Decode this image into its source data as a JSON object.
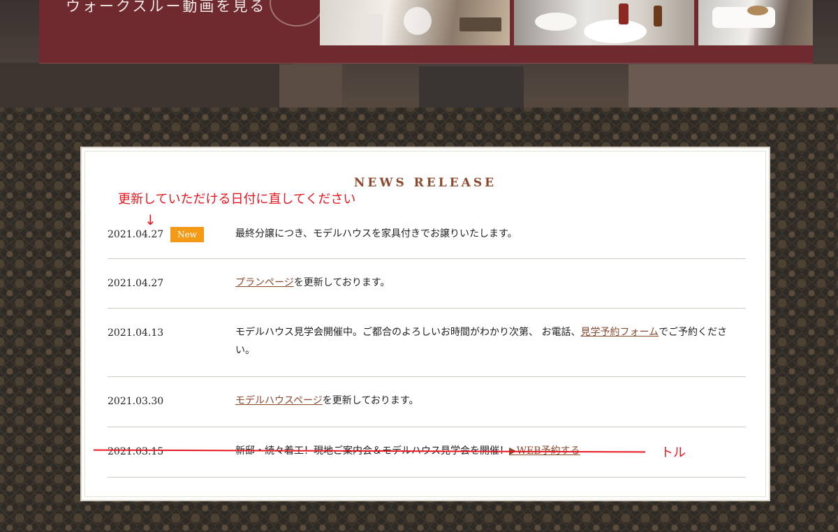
{
  "hero": {
    "walkthrough_label": "ウォークスルー動画を見る"
  },
  "news": {
    "title": "NEWS RELEASE",
    "new_badge": "New",
    "items": [
      {
        "date": "2021.04.27",
        "text": "最終分譲につき、モデルハウスを家具付きでお譲りいたします。"
      },
      {
        "date": "2021.04.27",
        "link": "プランページ",
        "text_after": "を更新しております。"
      },
      {
        "date": "2021.04.13",
        "text_before": "モデルハウス見学会開催中。ご都合のよろしいお時間がわかり次第、 お電話、",
        "link": "見学予約フォーム",
        "text_after": "でご予約ください。"
      },
      {
        "date": "2021.03.30",
        "link": "モデルハウスページ",
        "text_after": "を更新しております。"
      },
      {
        "date": "2021.03.15",
        "text_before": "新邸・続々着工！現地ご案内会＆モデルハウス見学会を開催！",
        "link": "▶WEB予約する"
      }
    ]
  },
  "annotations": {
    "date_note": "更新していただける日付に直してください",
    "arrow": "↓",
    "remove_note": "トル",
    "color": "#e8171f"
  }
}
